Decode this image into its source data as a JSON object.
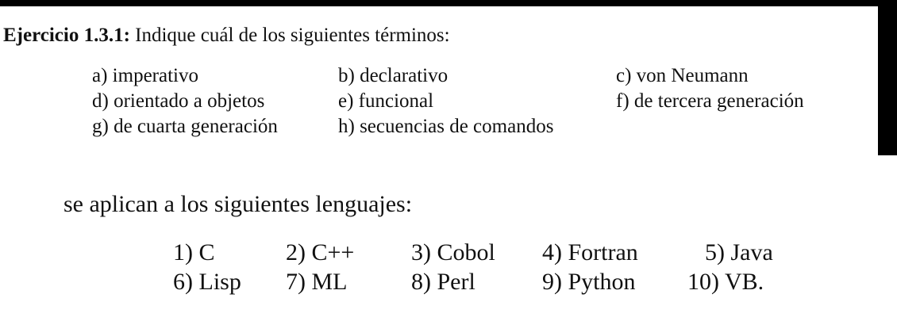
{
  "exercise": {
    "label": "Ejercicio 1.3.1:",
    "prompt": "Indique cuál de los siguientes términos:"
  },
  "terms": [
    {
      "text": "a) imperativo"
    },
    {
      "text": "b) declarativo"
    },
    {
      "text": "c) von Neumann"
    },
    {
      "text": "d) orientado a objetos"
    },
    {
      "text": "e) funcional"
    },
    {
      "text": "f) de tercera generación"
    },
    {
      "text": "g) de cuarta generación"
    },
    {
      "text": "h) secuencias de comandos"
    }
  ],
  "languages_intro": "se aplican a los siguientes lenguajes:",
  "languages": [
    {
      "text": "1) C"
    },
    {
      "text": "2) C++"
    },
    {
      "text": "3) Cobol"
    },
    {
      "text": "4) Fortran"
    },
    {
      "text": "5) Java"
    },
    {
      "text": "6) Lisp"
    },
    {
      "text": "7) ML"
    },
    {
      "text": "8) Perl"
    },
    {
      "text": "9) Python"
    },
    {
      "text": "10) VB."
    }
  ]
}
